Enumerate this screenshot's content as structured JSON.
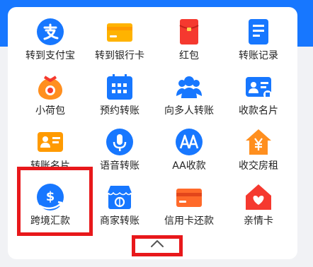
{
  "services": [
    {
      "label": "转到支付宝",
      "icon": "alipay-icon"
    },
    {
      "label": "转到银行卡",
      "icon": "bank-card-icon"
    },
    {
      "label": "红包",
      "icon": "red-envelope-icon"
    },
    {
      "label": "转账记录",
      "icon": "transfer-record-icon"
    },
    {
      "label": "小荷包",
      "icon": "small-pouch-icon"
    },
    {
      "label": "预约转账",
      "icon": "calendar-icon"
    },
    {
      "label": "向多人转账",
      "icon": "multi-person-icon"
    },
    {
      "label": "收款名片",
      "icon": "payment-card-icon"
    },
    {
      "label": "转账名片",
      "icon": "transfer-card-icon"
    },
    {
      "label": "语音转账",
      "icon": "microphone-icon"
    },
    {
      "label": "AA收款",
      "icon": "aa-icon"
    },
    {
      "label": "收交房租",
      "icon": "house-rent-icon"
    },
    {
      "label": "跨境汇款",
      "icon": "cross-border-dollar-icon"
    },
    {
      "label": "商家转账",
      "icon": "merchant-store-icon"
    },
    {
      "label": "信用卡还款",
      "icon": "credit-card-icon"
    },
    {
      "label": "亲情卡",
      "icon": "family-card-icon"
    }
  ],
  "collapse_icon": "chevron-up-icon",
  "colors": {
    "accent_blue": "#1777ff",
    "highlight_red": "#e8181b",
    "orange": "#ff8f1f",
    "red": "#f5392f"
  }
}
